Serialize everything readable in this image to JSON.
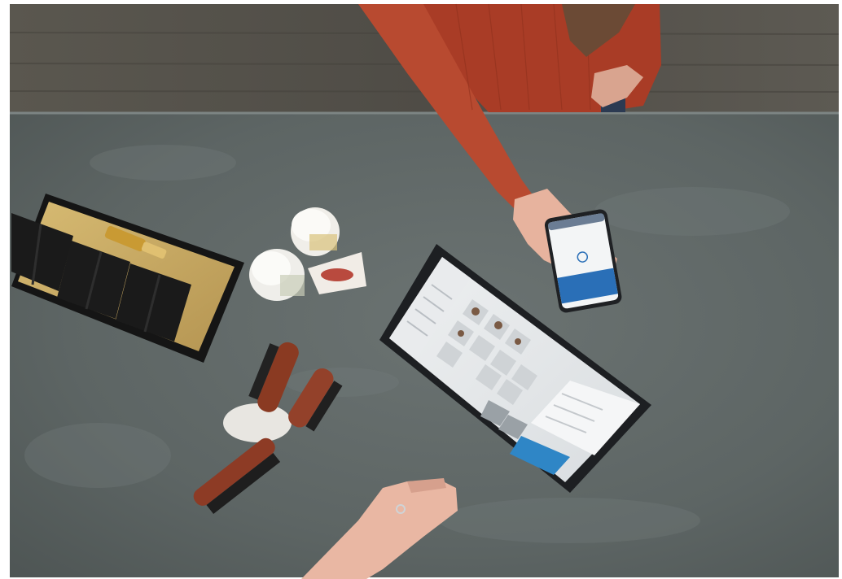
{
  "scene": {
    "description_colors": {
      "wall": "#55524c",
      "counter": "#5f6666",
      "sweater": "#b2412a",
      "skin": "#e9b7a3",
      "tablet_accent": "#2f86c6",
      "phone_accent": "#2a6fb7",
      "tray": "#c8a862",
      "brush_wood": "#8a3a22"
    }
  }
}
